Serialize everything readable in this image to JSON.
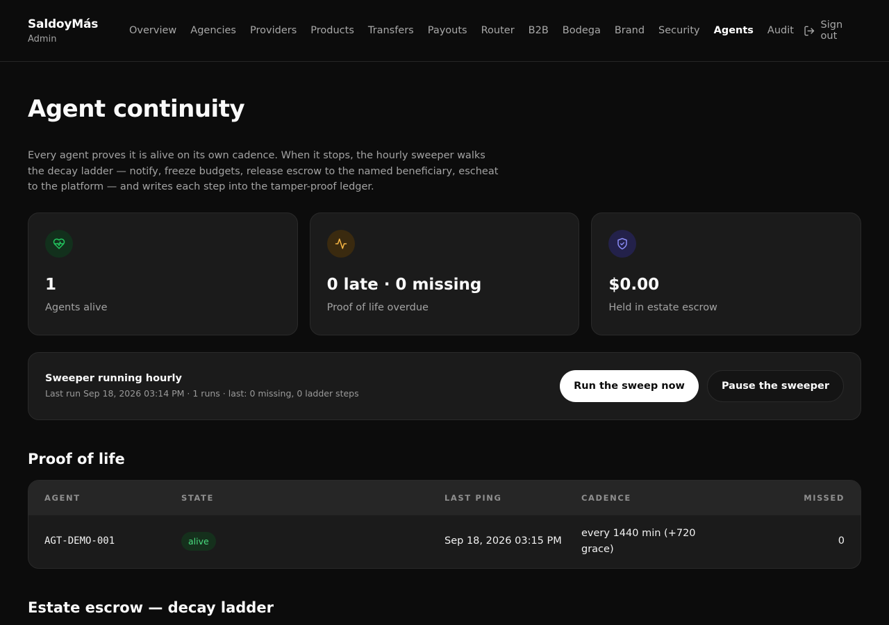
{
  "brand": {
    "name": "SaldoyMás",
    "role": "Admin"
  },
  "nav": {
    "items": [
      {
        "label": "Overview",
        "active": false
      },
      {
        "label": "Agencies",
        "active": false
      },
      {
        "label": "Providers",
        "active": false
      },
      {
        "label": "Products",
        "active": false
      },
      {
        "label": "Transfers",
        "active": false
      },
      {
        "label": "Payouts",
        "active": false
      },
      {
        "label": "Router",
        "active": false
      },
      {
        "label": "B2B",
        "active": false
      },
      {
        "label": "Bodega",
        "active": false
      },
      {
        "label": "Brand",
        "active": false
      },
      {
        "label": "Security",
        "active": false
      },
      {
        "label": "Agents",
        "active": true
      },
      {
        "label": "Audit",
        "active": false
      }
    ],
    "signout_label": "Sign out",
    "signout_icon": "sign-out-icon"
  },
  "page": {
    "title": "Agent continuity",
    "intro": "Every agent proves it is alive on its own cadence. When it stops, the hourly sweeper walks the decay ladder — notify, freeze budgets, release escrow to the named beneficiary, escheat to the platform — and writes each step into the tamper-proof ledger."
  },
  "stats": [
    {
      "icon": "heart-pulse-icon",
      "value": "1",
      "label": "Agents alive",
      "accent": "#22c55e",
      "bg": "#12301c"
    },
    {
      "icon": "activity-icon",
      "value": "0 late · 0 missing",
      "label": "Proof of life overdue",
      "accent": "#f5b544",
      "bg": "#3a2a0f"
    },
    {
      "icon": "shield-check-icon",
      "value": "$0.00",
      "label": "Held in estate escrow",
      "accent": "#8b8cf6",
      "bg": "#23214a"
    }
  ],
  "sweeper": {
    "title": "Sweeper running hourly",
    "subtitle": "Last run Sep 18, 2026 03:14 PM · 1 runs · last: 0 missing, 0 ladder steps",
    "run_label": "Run the sweep now",
    "pause_label": "Pause the sweeper"
  },
  "proof_of_life": {
    "title": "Proof of life",
    "columns": [
      "AGENT",
      "STATE",
      "LAST PING",
      "CADENCE",
      "MISSED"
    ],
    "rows": [
      {
        "agent": "AGT-DEMO-001",
        "state": "alive",
        "last_ping": "Sep 18, 2026 03:15 PM",
        "cadence": "every 1440 min (+720 grace)",
        "missed": "0"
      }
    ]
  },
  "estate": {
    "title": "Estate escrow — decay ladder"
  },
  "colors": {
    "background": "#0c0c0c",
    "card": "#1b1b1b",
    "alive_badge": "#4ade80"
  }
}
